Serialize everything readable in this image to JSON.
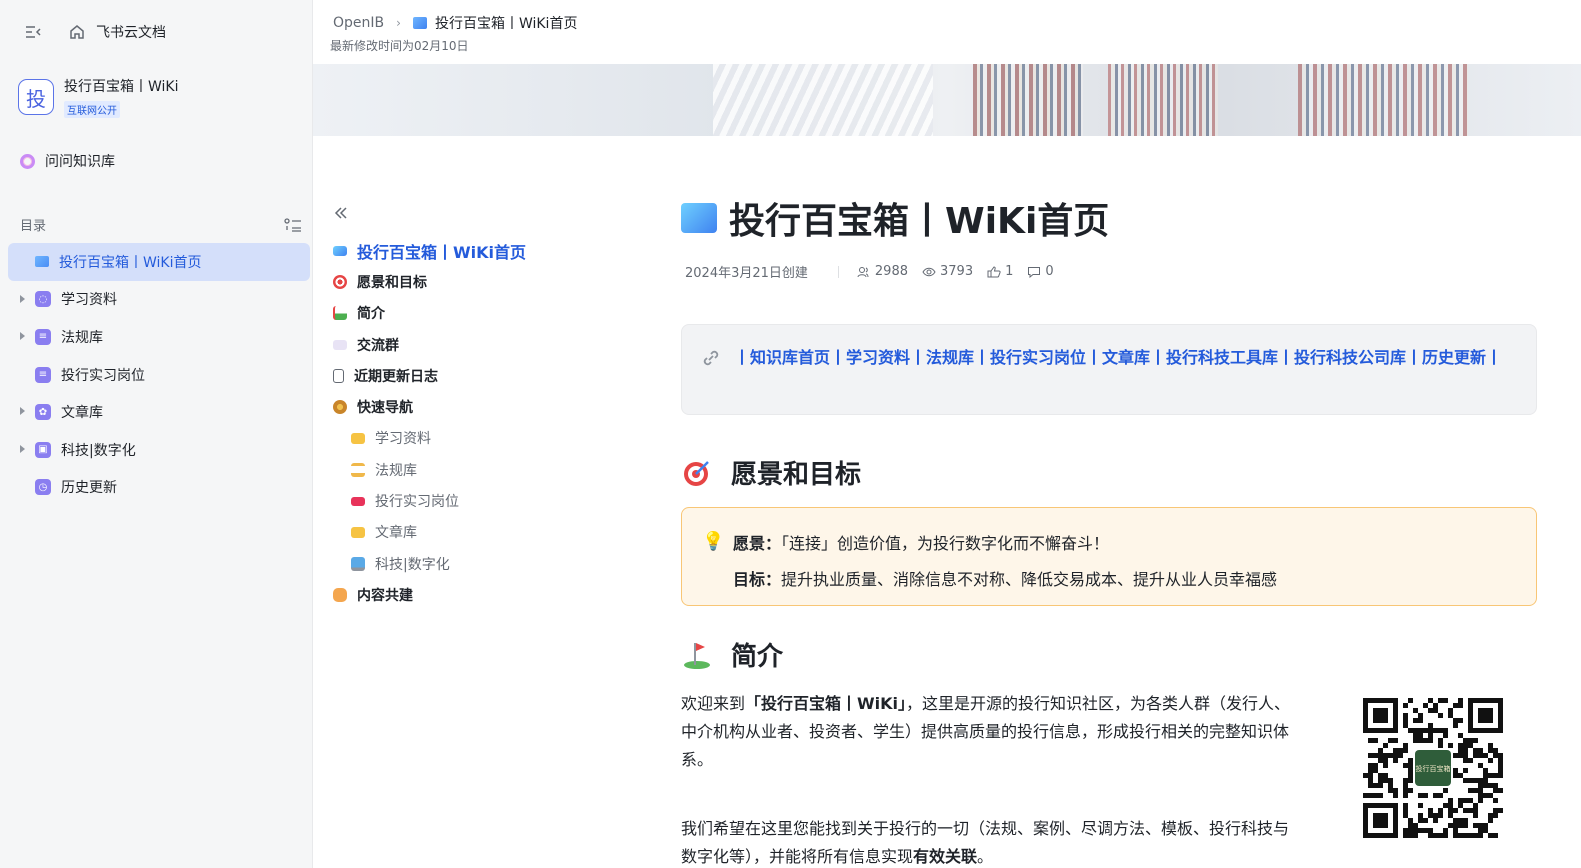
{
  "sidebar": {
    "brand": "飞书云文档",
    "space": {
      "avatar_char": "投",
      "name": "投行百宝箱丨WiKi",
      "badge": "互联网公开"
    },
    "ask_label": "问问知识库",
    "toc_label": "目录",
    "items": [
      {
        "label": "投行百宝箱丨WiKi首页"
      },
      {
        "label": "学习资料"
      },
      {
        "label": "法规库"
      },
      {
        "label": "投行实习岗位"
      },
      {
        "label": "文章库"
      },
      {
        "label": "科技|数字化"
      },
      {
        "label": "历史更新"
      }
    ]
  },
  "header": {
    "crumb_root": "OpenIB",
    "crumb_page": "投行百宝箱丨WiKi首页",
    "modified": "最新修改时间为02月10日"
  },
  "outline": {
    "items": [
      {
        "label": "投行百宝箱丨WiKi首页"
      },
      {
        "label": "愿景和目标"
      },
      {
        "label": "简介"
      },
      {
        "label": "交流群"
      },
      {
        "label": "近期更新日志"
      },
      {
        "label": "快速导航"
      },
      {
        "label": "学习资料"
      },
      {
        "label": "法规库"
      },
      {
        "label": "投行实习岗位"
      },
      {
        "label": "文章库"
      },
      {
        "label": "科技|数字化"
      },
      {
        "label": "内容共建"
      }
    ]
  },
  "doc": {
    "title": "投行百宝箱丨WiKi首页",
    "created": "2024年3月21日创建",
    "stats": {
      "readers": "2988",
      "views": "3793",
      "likes": "1",
      "comments": "0"
    },
    "links_text": "丨知识库首页丨学习资料丨法规库丨投行实习岗位丨文章库丨投行科技工具库丨投行科技公司库丨历史更新丨",
    "section_vision": "愿景和目标",
    "vision_label": "愿景：",
    "vision_text": "「连接」创造价值，为投行数字化而不懈奋斗！",
    "goal_label": "目标：",
    "goal_text": "提升执业质量、消除信息不对称、降低交易成本、提升从业人员幸福感",
    "section_intro": "简介",
    "intro_pre": "欢迎来到",
    "intro_bold": "「投行百宝箱丨WiKi」",
    "intro_post": "，这里是开源的投行知识社区，为各类人群（发行人、中介机构从业者、投资者、学生）提供高质量的投行信息，形成投行相关的完整知识体系。",
    "intro2_pre": "我们希望在这里您能找到关于投行的一切（法规、案例、尽调方法、模板、投行科技与数字化等），并能将所有信息实现",
    "intro2_bold": "有效关联",
    "intro2_post": "。",
    "qr_center": "投行百宝箱"
  },
  "colors": {
    "accent": "#245bdb",
    "active_bg": "#d4dffa",
    "callout_bg": "#fef6e9",
    "callout_border": "#f8c676"
  }
}
